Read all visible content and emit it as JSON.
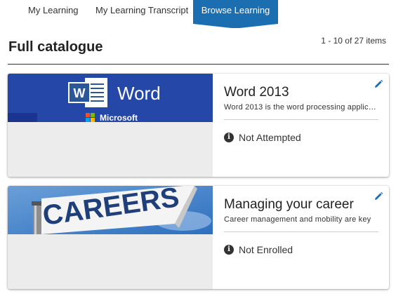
{
  "tabs": [
    {
      "label": "My Learning",
      "active": false
    },
    {
      "label": "My Learning Transcript",
      "active": false
    },
    {
      "label": "Browse Learning",
      "active": true
    }
  ],
  "header": {
    "title": "Full catalogue",
    "item_count": "1 - 10 of 27 items"
  },
  "colors": {
    "accent": "#1b6fb0",
    "word_blue": "#2b579a",
    "thumb_placeholder": "#ececec"
  },
  "courses": [
    {
      "thumbnail": {
        "word_logo_text": "Word",
        "brand_text": "Microsoft"
      },
      "title": "Word 2013",
      "description": "Word 2013 is the word processing application",
      "status": "Not Attempted",
      "status_icon": "info-icon"
    },
    {
      "thumbnail": {
        "sign_text": "CAREERS"
      },
      "title": "Managing your career",
      "description": "Career management and mobility are key",
      "status": "Not Enrolled",
      "status_icon": "info-icon"
    }
  ]
}
